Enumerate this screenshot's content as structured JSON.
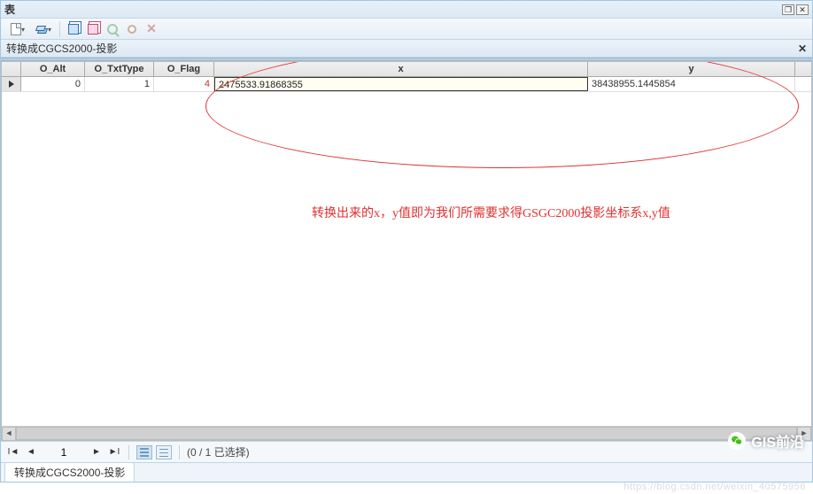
{
  "window": {
    "title": "表"
  },
  "tab": {
    "name": "转换成CGCS2000-投影"
  },
  "toolbar": {
    "items": [
      {
        "name": "new-doc-dropdown",
        "icon": "doc"
      },
      {
        "name": "layers-dropdown",
        "icon": "layers"
      },
      {
        "name": "sep"
      },
      {
        "name": "copy-button",
        "icon": "copy"
      },
      {
        "name": "copy2-button",
        "icon": "copy"
      },
      {
        "name": "find-button",
        "icon": "search",
        "dim": true
      },
      {
        "name": "target-button",
        "icon": "pin",
        "dim": true
      },
      {
        "name": "delete-button",
        "icon": "x",
        "dim": true
      }
    ]
  },
  "table": {
    "columns": [
      "",
      "O_Alt",
      "O_TxtType",
      "O_Flag",
      "x",
      "y"
    ],
    "rows": [
      {
        "O_Alt": "0",
        "O_TxtType": "1",
        "O_Flag": "4",
        "x": "2475533.91868355",
        "y": "38438955.1445854"
      }
    ]
  },
  "nav": {
    "page": "1",
    "status": "(0 / 1 已选择)"
  },
  "bottomTab": {
    "label": "转换成CGCS2000-投影"
  },
  "annotation": {
    "text": "转换出来的x，y值即为我们所需要求得GSGC2000投影坐标系x,y值"
  },
  "watermark": {
    "brand": "GIS前沿",
    "url": "https://blog.csdn.net/weixin_40575956"
  }
}
